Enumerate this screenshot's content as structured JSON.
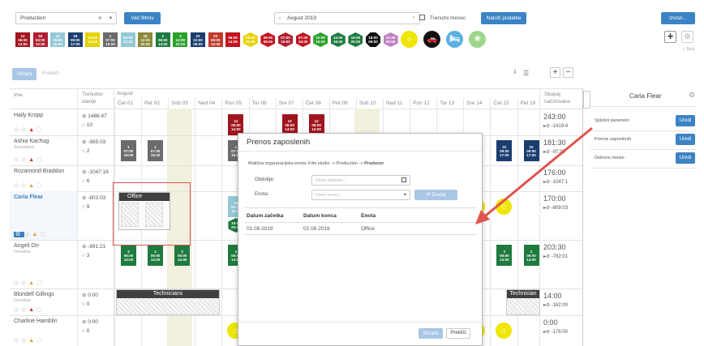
{
  "toolbar": {
    "org_unit": "Production",
    "more_filters": "Več filtrov",
    "period": "Avgust 2019",
    "current_month": "Trenutni mesec",
    "load_data": "Naloži podatke",
    "export": "Izvozi...",
    "collapse": "« Skrij"
  },
  "shift_chips": [
    {
      "n": "12",
      "t1": "06:00",
      "t2": "14:00",
      "color": "#a0141e",
      "shape": "sq"
    },
    {
      "n": "18",
      "t1": "04:00",
      "t2": "12:00",
      "color": "#b01e2e",
      "shape": "sq"
    },
    {
      "n": "13",
      "t1": "08:00",
      "t2": "15:00",
      "color": "#93c9d6",
      "shape": "sq"
    },
    {
      "n": "18",
      "t1": "09:00",
      "t2": "17:00",
      "color": "#1a3d6e",
      "shape": "sq"
    },
    {
      "n": "",
      "t1": "06:00",
      "t2": "14:00",
      "color": "#e4d200",
      "shape": "sq"
    },
    {
      "n": "1",
      "t1": "07:00",
      "t2": "15:00",
      "color": "#6b6b6b",
      "shape": "sq"
    },
    {
      "n": "",
      "t1": "04:00",
      "t2": "12:00",
      "color": "#93c9d6",
      "shape": "sq"
    },
    {
      "n": "18",
      "t1": "12:30",
      "t2": "20:00",
      "color": "#8a8a3a",
      "shape": "sq"
    },
    {
      "n": "2",
      "t1": "06:00",
      "t2": "14:00",
      "color": "#1e7a3e",
      "shape": "sq"
    },
    {
      "n": "3",
      "t1": "14:00",
      "t2": "22:00",
      "color": "#2aa02a",
      "shape": "sq"
    },
    {
      "n": "22",
      "t1": "22:00",
      "t2": "06:00",
      "color": "#1a3d6e",
      "shape": "sq"
    },
    {
      "n": "23",
      "t1": "06:00",
      "t2": "14:00",
      "color": "#c0392b",
      "shape": "sq"
    },
    {
      "n": "",
      "t1": "06:00",
      "t2": "14:00",
      "color": "#c0141e",
      "shape": "sq"
    },
    {
      "n": "",
      "t1": "09:00",
      "t2": "00:00",
      "color": "#e4d200",
      "shape": "hex"
    },
    {
      "n": "",
      "t1": "06:00",
      "t2": "08:00",
      "color": "#c0141e",
      "shape": "hex"
    },
    {
      "n": "",
      "t1": "07:00",
      "t2": "15:00",
      "color": "#b01e2e",
      "shape": "hex"
    },
    {
      "n": "",
      "t1": "07:00",
      "t2": "15:00",
      "color": "#c0141e",
      "shape": "hex"
    },
    {
      "n": "",
      "t1": "12:00",
      "t2": "15:00",
      "color": "#2aa02a",
      "shape": "hex"
    },
    {
      "n": "",
      "t1": "14:00",
      "t2": "16:00",
      "color": "#1e7a3e",
      "shape": "hex"
    },
    {
      "n": "",
      "t1": "19:00",
      "t2": "20:00",
      "color": "#1e7a3e",
      "shape": "hex"
    },
    {
      "n": "",
      "t1": "19:00",
      "t2": "06:00",
      "color": "#111111",
      "shape": "oct"
    },
    {
      "n": "",
      "t1": "22:00",
      "t2": "00:00",
      "color": "#c080c0",
      "shape": "hex"
    },
    {
      "n": "",
      "t1": "",
      "t2": "",
      "color": "#eee600",
      "shape": "circ",
      "icon": "☼"
    },
    {
      "n": "",
      "t1": "",
      "t2": "",
      "color": "#111111",
      "shape": "circ",
      "icon": "🚗"
    },
    {
      "n": "",
      "t1": "",
      "t2": "",
      "color": "#5bb0e0",
      "shape": "circ",
      "icon": "🛏"
    },
    {
      "n": "",
      "t1": "",
      "t2": "",
      "color": "#9dd68a",
      "shape": "circ",
      "icon": "✳"
    }
  ],
  "grid": {
    "save": "Shrani",
    "cancel": "Prekliči",
    "headers": {
      "name": "Ime",
      "state": "Trenutno stanje",
      "month": "Avgust",
      "total": "Skupaj načrtovano"
    },
    "days": [
      "Čet 01",
      "Pet 02",
      "Sob 03",
      "Ned 04",
      "Pon 05",
      "Tor 06",
      "Sre 07",
      "Čet 08",
      "Pet 09",
      "Sob 10",
      "Ned 11",
      "Pon 12",
      "Tor 13",
      "Sre 14",
      "Čet 15",
      "Pet 16"
    ],
    "office_label": "Office",
    "technicians_label": "Technicians",
    "technicians_label_short": "Technician",
    "rows": [
      {
        "name": "Haily Kropp",
        "sub": "",
        "s1": "⊘ 1486:47",
        "s2": "○ 10",
        "t1": "243:00",
        "t2": "▸⊘ -1419:4",
        "cells": [
          {
            "d": 4,
            "n": "12",
            "a": "06:00",
            "b": "14:00",
            "c": "#a0141e"
          },
          {
            "d": 6,
            "n": "12",
            "a": "06:00",
            "b": "14:00",
            "c": "#a0141e"
          },
          {
            "d": 7,
            "n": "12",
            "a": "06:00",
            "b": "14:00",
            "c": "#a0141e"
          }
        ]
      },
      {
        "name": "Ashia Kachug",
        "sub": "Sezavjalect",
        "s1": "⊘ -985:03",
        "s2": "○ 2",
        "t1": "181:30",
        "t2": "▸⊘ -97:33",
        "cells": [
          {
            "d": 0,
            "n": "1",
            "a": "07:00",
            "b": "15:00",
            "c": "#6b6b6b"
          },
          {
            "d": 1,
            "n": "1",
            "a": "07:00",
            "b": "15:00",
            "c": "#6b6b6b"
          },
          {
            "d": 4,
            "n": "1",
            "a": "07:00",
            "b": "15:00",
            "c": "#6b6b6b"
          },
          {
            "d": 14,
            "n": "10",
            "a": "09:00",
            "b": "17:00",
            "c": "#1a3d6e"
          },
          {
            "d": 15,
            "n": "10",
            "a": "09:00",
            "b": "17:00",
            "c": "#1a3d6e"
          }
        ]
      },
      {
        "name": "Rozamond Braddon",
        "sub": "",
        "s1": "⊘ -1047:16",
        "s2": "○ 6",
        "t1": "176:00",
        "t2": "▸⊘ -1047:1",
        "cells": []
      },
      {
        "name": "Caria Flear",
        "sub": "",
        "s1": "⊘ -803:03",
        "s2": "○ 9",
        "t1": "170:00",
        "t2": "▸⊘ -809:03",
        "cells": [
          {
            "d": 4,
            "n": "18",
            "a": "04:00",
            "b": "12:00",
            "c": "#93c9d6"
          },
          {
            "d": 4,
            "n": "",
            "a": "19:00",
            "b": "20:00",
            "c": "#1e7a3e",
            "hex": true
          }
        ],
        "selected": true,
        "suns": [
          13,
          14
        ]
      },
      {
        "name": "Angeli Orr",
        "sub": "Ferrailasi",
        "s1": "⊘ -891:21",
        "s2": "○ 3",
        "t1": "203:30",
        "t2": "▸⊘ -782:01",
        "cells": [
          {
            "d": 0,
            "n": "2",
            "a": "06:00",
            "b": "14:00",
            "c": "#1e7a3e"
          },
          {
            "d": 1,
            "n": "2",
            "a": "06:00",
            "b": "14:00",
            "c": "#1e7a3e"
          },
          {
            "d": 2,
            "n": "2",
            "a": "06:00",
            "b": "14:00",
            "c": "#1e7a3e"
          },
          {
            "d": 4,
            "n": "2",
            "a": "06:00",
            "b": "14:00",
            "c": "#1e7a3e"
          },
          {
            "d": 14,
            "n": "2",
            "a": "06:00",
            "b": "14:00",
            "c": "#1e7a3e"
          },
          {
            "d": 15,
            "n": "2",
            "a": "06:00",
            "b": "14:00",
            "c": "#1e7a3e"
          }
        ]
      },
      {
        "name": "Blondell Gillings",
        "sub": "Ferrailasi",
        "s1": "⊘ 0:00",
        "s2": "○ 0",
        "t1": "14:00",
        "t2": "▸⊘ -162:00",
        "cells": []
      },
      {
        "name": "Charline Hamblin",
        "sub": "",
        "s1": "⊘ 0:00",
        "s2": "○ 0",
        "t1": "0:00",
        "t2": "▸⊘ -176:00",
        "cells": [],
        "suns": [
          4,
          13,
          14
        ]
      }
    ]
  },
  "right_panel": {
    "employee": "Caria Flear",
    "items": [
      {
        "label": "Splošni parametri",
        "button": "Uredi"
      },
      {
        "label": "Prenos zaposlenih",
        "button": "Uredi"
      },
      {
        "label": "Delovno mesto",
        "button": "Uredi"
      }
    ]
  },
  "modal": {
    "title": "Prenos zaposlenih",
    "org_label": "Matična organizacijska enota:",
    "org_path": "Film studio -> Production ->",
    "org_leaf": "Producer",
    "period_label": "Obdobje:",
    "period_placeholder": "Izberi obdobje...",
    "unit_label": "Enota:",
    "unit_placeholder": "Izberi enoto...",
    "add_button": " Dodaj",
    "table": {
      "headers": [
        "Datum začetka",
        "Datum konca",
        "Enota"
      ],
      "rows": [
        [
          "01.08.2019",
          "02.08.2019",
          "Office"
        ]
      ]
    },
    "save": "Shrani",
    "cancel": "Prekliči"
  }
}
